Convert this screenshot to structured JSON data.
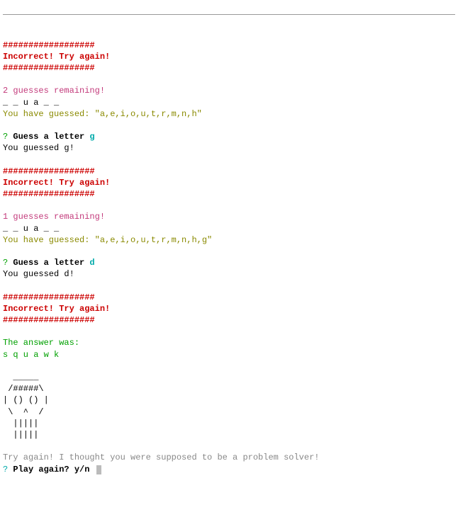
{
  "rounds": [
    {
      "hashes": "##################",
      "incorrect_msg": "Incorrect! Try again!",
      "remaining_text": "2 guesses remaining!",
      "word_progress": "_ _ u a _ _",
      "guessed_label": "You have guessed: ",
      "guessed_value": "\"a,e,i,o,u,t,r,m,n,h\"",
      "prompt_q": "?",
      "prompt_text": " Guess a letter ",
      "guess_input": "g",
      "you_guessed": "You guessed g!"
    },
    {
      "hashes": "##################",
      "incorrect_msg": "Incorrect! Try again!",
      "remaining_text": "1 guesses remaining!",
      "word_progress": "_ _ u a _ _",
      "guessed_label": "You have guessed: ",
      "guessed_value": "\"a,e,i,o,u,t,r,m,n,h,g\"",
      "prompt_q": "?",
      "prompt_text": " Guess a letter ",
      "guess_input": "d",
      "you_guessed": "You guessed d!"
    }
  ],
  "final": {
    "hashes": "##################",
    "incorrect_msg": "Incorrect! Try again!",
    "answer_label": "The answer was:",
    "answer_value": "s q u a w k"
  },
  "art": {
    "l1": "  _____ ",
    "l2": " /#####\\",
    "l3": "| () () |",
    "l4": " \\  ^  /",
    "l5": "  |||||",
    "l6": "  |||||"
  },
  "footer": {
    "taunt": "Try again! I thought you were supposed to be a problem solver!",
    "prompt_q": "?",
    "prompt_text": " Play again? y/n "
  }
}
